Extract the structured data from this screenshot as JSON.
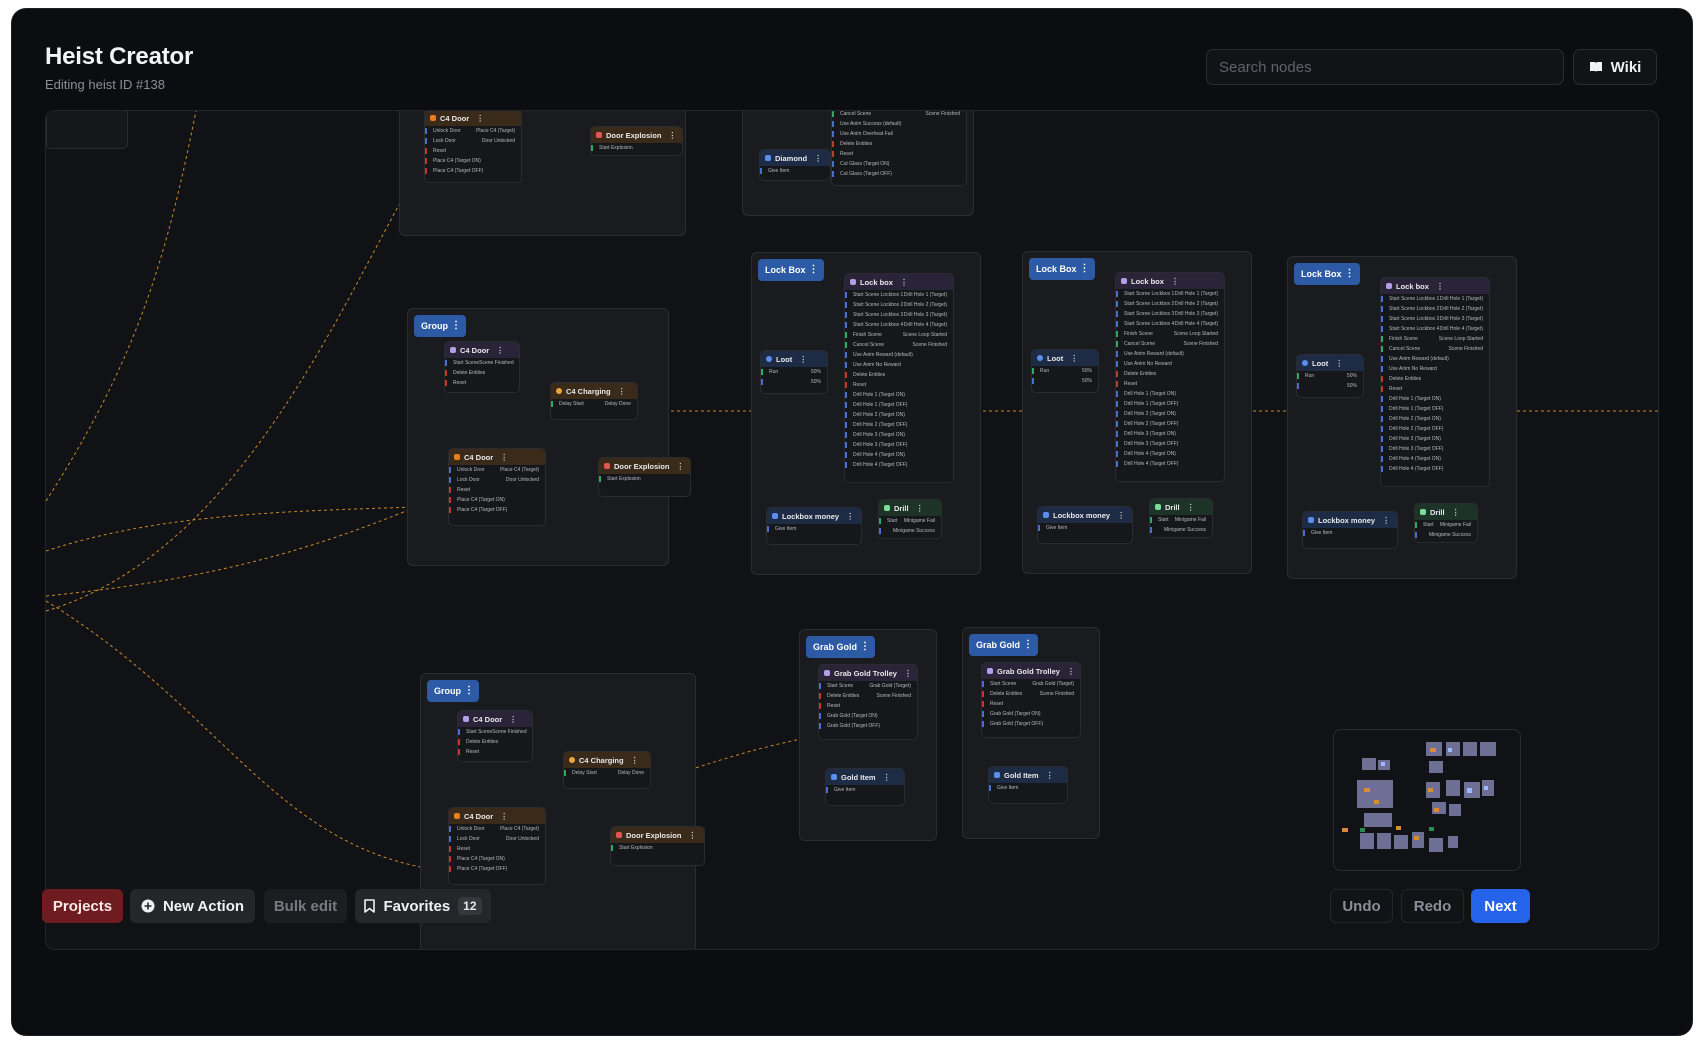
{
  "header": {
    "title": "Heist Creator",
    "subtitle": "Editing heist ID #138",
    "search_placeholder": "Search nodes",
    "wiki_label": "Wiki"
  },
  "toolbar": {
    "projects_label": "Projects",
    "new_action_label": "New Action",
    "bulk_edit_label": "Bulk edit",
    "favorites_label": "Favorites",
    "favorites_count": "12",
    "undo_label": "Undo",
    "redo_label": "Redo",
    "next_label": "Next"
  },
  "colors": {
    "accent": "#2563eb",
    "projects": "#6e1c1f",
    "group_label": "#2d5aa5",
    "wire": "#c98a2a",
    "canvas_bg": "#111215"
  },
  "canvas": {
    "groups": [
      {
        "label": "Group"
      },
      {
        "label": "Lock Box"
      },
      {
        "label": "Lock Box"
      },
      {
        "label": "Lock Box"
      },
      {
        "label": "Group"
      },
      {
        "label": "Grab Gold"
      },
      {
        "label": "Grab Gold"
      }
    ],
    "nodes": {
      "c4_door": "C4 Door",
      "door_explosion": "Door Explosion",
      "diamond": "Diamond",
      "c4_charging": "C4 Charging",
      "lock_box": "Lock box",
      "loot": "Loot",
      "lockbox_money": "Lockbox money",
      "drill": "Drill",
      "grab_gold_trolley": "Grab Gold Trolley",
      "gold_item": "Gold Item"
    }
  }
}
